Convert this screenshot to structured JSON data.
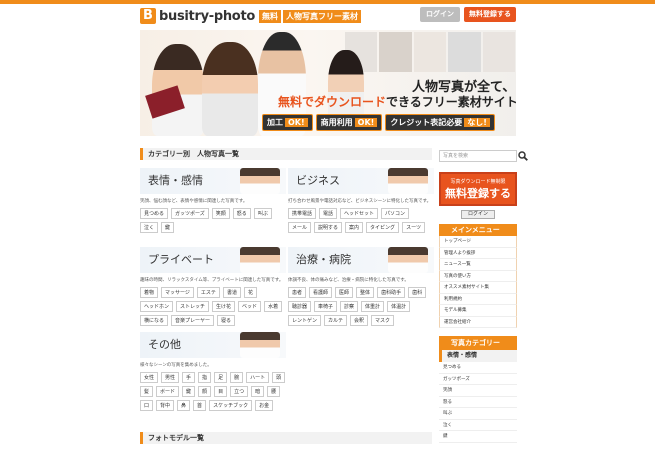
{
  "header": {
    "logo_letter": "B",
    "logo_text": "busitry-photo",
    "logo_free": "無料",
    "logo_sub": "人物写真フリー素材",
    "login_label": "ログイン",
    "register_label": "無料登録する",
    "accent": "#f08c1a",
    "register_color": "#e8541e"
  },
  "hero": {
    "line1": "人物写真が全て、",
    "line2_pre": "無料でダウンロード",
    "line2_post": "できるフリー素材サイト",
    "badges": [
      {
        "text": "加工",
        "ok": "OK!"
      },
      {
        "text": "商用利用",
        "ok": "OK!"
      },
      {
        "text": "クレジット表記必要",
        "ok": "なし!"
      }
    ]
  },
  "main": {
    "category_heading": "カテゴリー別　人物写真一覧",
    "categories": [
      {
        "title": "表情・感情",
        "desc": "笑顔、悩む顔など、表情や感情に関連した写真です。",
        "tags": [
          "見つめる",
          "ガッツポーズ",
          "笑顔",
          "怒る",
          "叫ぶ",
          "泣く",
          "鍵"
        ]
      },
      {
        "title": "ビジネス",
        "desc": "打ち合わせ風景や電話対応など、ビジネスシーンに特化した写真です。",
        "tags": [
          "携帯電話",
          "電話",
          "ヘッドセット",
          "パソコン",
          "メール",
          "説明する",
          "案内",
          "タイピング",
          "スーツ"
        ]
      },
      {
        "title": "プライベート",
        "desc": "趣味の時間、リラックスタイム等、プライベートに関連した写真です。",
        "tags": [
          "着物",
          "マッサージ",
          "エステ",
          "書道",
          "花",
          "ヘッドホン",
          "ストレッチ",
          "生け花",
          "ベッド",
          "水着",
          "横になる",
          "音楽プレーヤー",
          "寝る"
        ]
      },
      {
        "title": "治療・病院",
        "desc": "体調不良、体の痛みなど、治療・病院に特化した写真です。",
        "tags": [
          "患者",
          "看護師",
          "医師",
          "整体",
          "歯科助手",
          "歯科",
          "聴診器",
          "車椅子",
          "診察",
          "体重計",
          "体温計",
          "レントゲン",
          "カルテ",
          "会釈",
          "マスク"
        ]
      },
      {
        "title": "その他",
        "desc": "様々なシーンの写真を集めました。",
        "tags": [
          "女性",
          "男性",
          "手",
          "指",
          "足",
          "腕",
          "ハート",
          "頭",
          "髪",
          "ボード",
          "鍵",
          "顔",
          "目",
          "立つ",
          "暗",
          "腰",
          "口",
          "背中",
          "鼻",
          "首",
          "スケッチブック",
          "お金"
        ]
      }
    ],
    "models_heading": "フォトモデル一覧"
  },
  "sidebar": {
    "search_placeholder": "写真を検索",
    "reg_small": "写真ダウンロード無制限",
    "reg_big": "無料登録する",
    "login_label": "ログイン",
    "menu_title": "メインメニュー",
    "menu_items": [
      "トップページ",
      "管理人より挨拶",
      "ニュース一覧",
      "写真の使い方",
      "オススメ素材サイト集",
      "利用規約",
      "モデル募集",
      "運営会社紹介"
    ],
    "cat_title": "写真カテゴリー",
    "cat_sub": "表情・感情",
    "cat_items": [
      "見つめる",
      "ガッツポーズ",
      "笑顔",
      "怒る",
      "叫ぶ",
      "泣く",
      "鍵"
    ]
  }
}
